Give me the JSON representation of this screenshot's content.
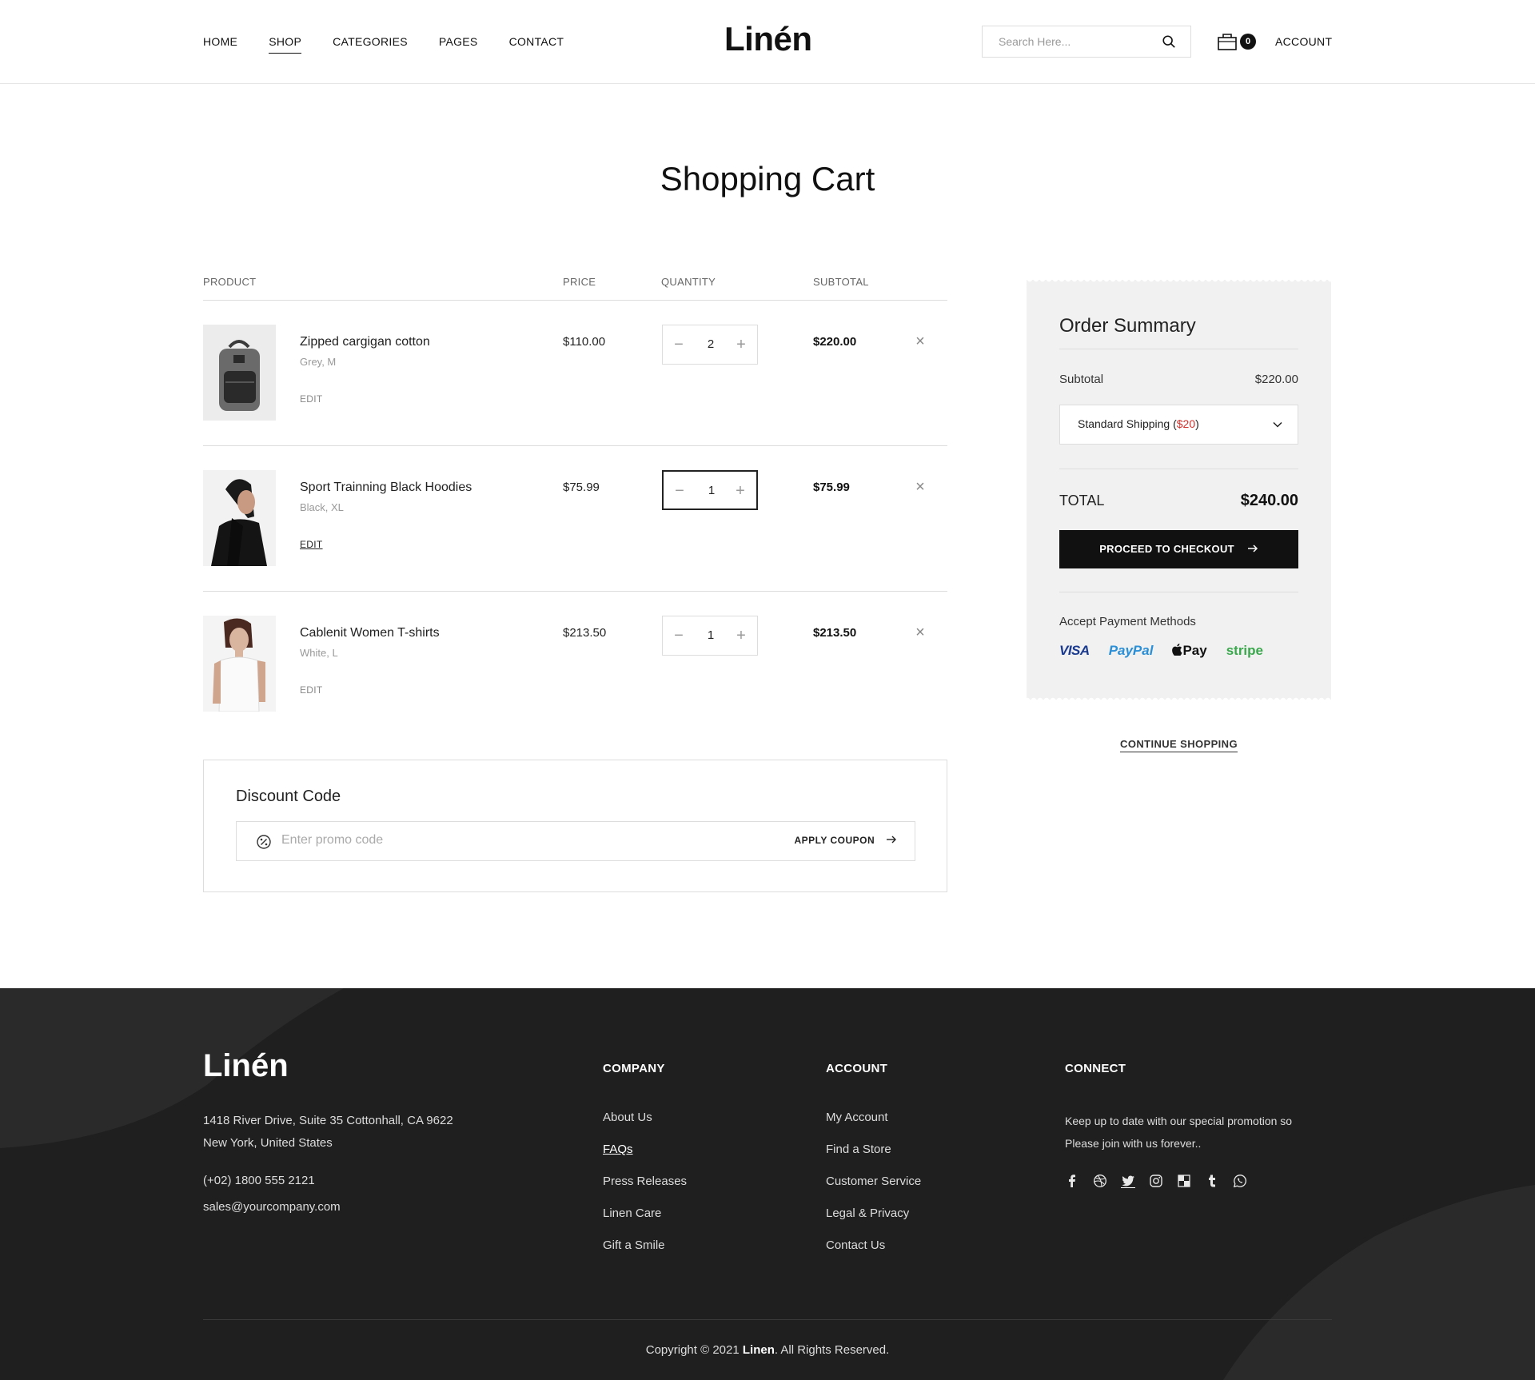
{
  "header": {
    "nav": [
      "HOME",
      "SHOP",
      "CATEGORIES",
      "PAGES",
      "CONTACT"
    ],
    "active_nav": "SHOP",
    "logo": "Linén",
    "search_placeholder": "Search Here...",
    "cart_count": "0",
    "account": "ACCOUNT"
  },
  "page_title": "Shopping Cart",
  "cart": {
    "columns": {
      "product": "PRODUCT",
      "price": "PRICE",
      "quantity": "QUANTITY",
      "subtotal": "SUBTOTAL"
    },
    "items": [
      {
        "name": "Zipped cargigan cotton",
        "variant": "Grey, M",
        "edit": "EDIT",
        "price": "$110.00",
        "qty": "2",
        "subtotal": "$220.00",
        "remove": "×",
        "minus": "−",
        "plus": "+"
      },
      {
        "name": "Sport Trainning Black Hoodies",
        "variant": "Black, XL",
        "edit": "EDIT",
        "price": "$75.99",
        "qty": "1",
        "subtotal": "$75.99",
        "remove": "×",
        "minus": "−",
        "plus": "+"
      },
      {
        "name": "Cablenit Women T-shirts",
        "variant": "White, L",
        "edit": "EDIT",
        "price": "$213.50",
        "qty": "1",
        "subtotal": "$213.50",
        "remove": "×",
        "minus": "−",
        "plus": "+"
      }
    ]
  },
  "discount": {
    "title": "Discount Code",
    "placeholder": "Enter promo code",
    "apply": "APPLY COUPON"
  },
  "summary": {
    "title": "Order Summary",
    "subtotal_label": "Subtotal",
    "subtotal_value": "$220.00",
    "shipping_label": "Standard Shipping (",
    "shipping_price": "$20",
    "shipping_close": ")",
    "total_label": "TOTAL",
    "total_value": "$240.00",
    "checkout": "PROCEED TO CHECKOUT",
    "payment_label": "Accept Payment Methods",
    "payment_methods": [
      "VISA",
      "PayPal",
      "Pay",
      "stripe"
    ],
    "continue": "CONTINUE SHOPPING"
  },
  "footer": {
    "logo": "Linén",
    "address_line1": "1418 River Drive, Suite 35 Cottonhall, CA 9622",
    "address_line2": "New York, United States",
    "phone": "(+02) 1800 555 2121",
    "email": "sales@yourcompany.com",
    "company": {
      "title": "COMPANY",
      "links": [
        "About Us",
        "FAQs",
        "Press Releases",
        "Linen Care",
        "Gift a Smile"
      ]
    },
    "account": {
      "title": "ACCOUNT",
      "links": [
        "My Account",
        "Find a Store",
        "Customer Service",
        "Legal & Privacy",
        "Contact Us"
      ]
    },
    "connect": {
      "title": "CONNECT",
      "text": "Keep up to date with our special promotion so Please join with us forever.."
    },
    "social": [
      "facebook-icon",
      "dribbble-icon",
      "twitter-icon",
      "instagram-icon",
      "squares-icon",
      "tumblr-icon",
      "whatsapp-icon"
    ],
    "copyright_prefix": "Copyright © 2021 ",
    "copyright_brand": "Linen",
    "copyright_suffix": ". All Rights Reserved."
  },
  "colors": {
    "accent": "#111111",
    "summary_bg": "#f1f1f1",
    "footer_bg": "#1f1f1f",
    "shipping_price": "#d0302b"
  }
}
